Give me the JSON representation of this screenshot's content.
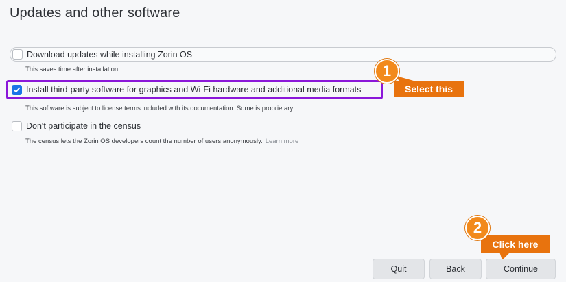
{
  "page": {
    "title": "Updates and other software"
  },
  "options": [
    {
      "label": "Download updates while installing Zorin OS",
      "description": "This saves time after installation.",
      "checked": false
    },
    {
      "label": "Install third-party software for graphics and Wi-Fi hardware and additional media formats",
      "description": "This software is subject to license terms included with its documentation. Some is proprietary.",
      "checked": true
    },
    {
      "label": "Don't participate in the census",
      "description": "The census lets the Zorin OS developers count the number of users anonymously.",
      "link": "Learn more",
      "checked": false
    }
  ],
  "annotations": {
    "step1": {
      "number": "1",
      "text": "Select this"
    },
    "step2": {
      "number": "2",
      "text": "Click here"
    }
  },
  "buttons": {
    "quit": "Quit",
    "back": "Back",
    "continue": "Continue"
  },
  "colors": {
    "checkbox_checked": "#1a73e8",
    "highlight_border": "#8b17d9",
    "annotation_orange": "#e8730e"
  }
}
